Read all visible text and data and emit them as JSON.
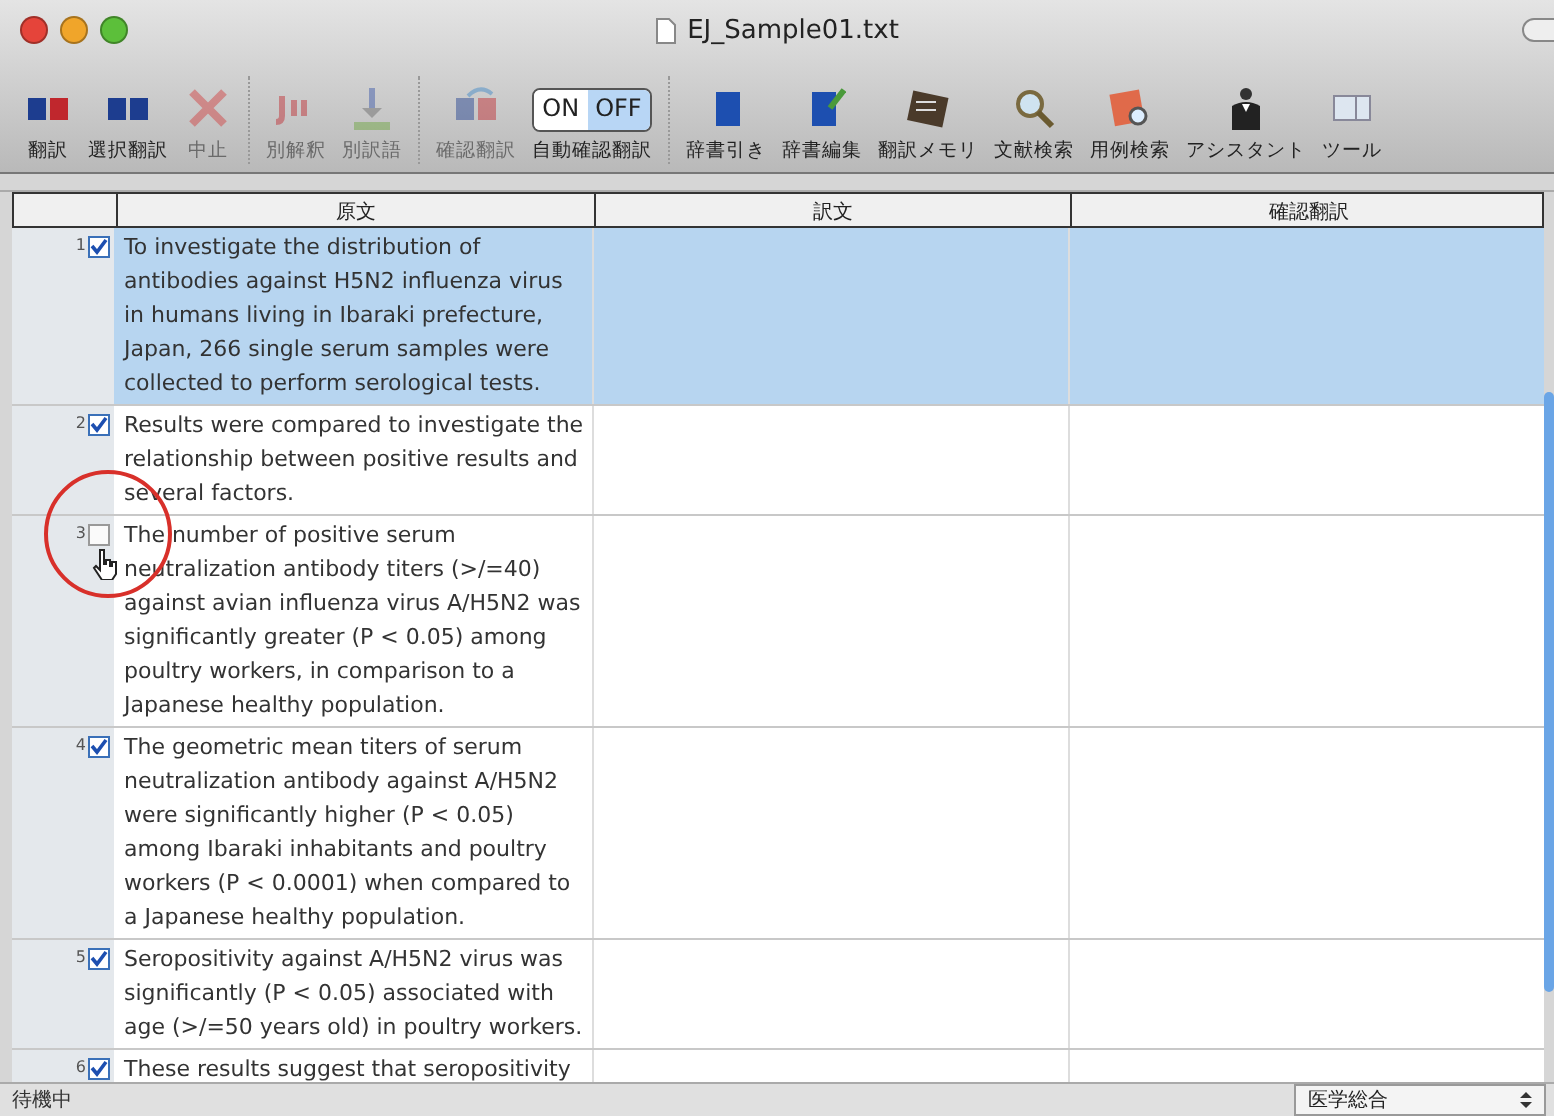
{
  "window": {
    "title": "EJ_Sample01.txt"
  },
  "toolbar": [
    {
      "kind": "exj",
      "label": "翻訳",
      "disabled": false,
      "separator_after": false
    },
    {
      "kind": "exj-select",
      "label": "選択翻訳",
      "disabled": false,
      "separator_after": false
    },
    {
      "kind": "stop",
      "label": "中止",
      "disabled": true,
      "separator_after": true
    },
    {
      "kind": "alt-meaning",
      "label": "別解釈",
      "disabled": true,
      "separator_after": false
    },
    {
      "kind": "alt-word",
      "label": "別訳語",
      "disabled": true,
      "separator_after": true
    },
    {
      "kind": "check",
      "label": "確認翻訳",
      "disabled": true,
      "separator_after": false
    },
    {
      "kind": "toggle",
      "label": "自動確認翻訳",
      "disabled": false,
      "separator_after": true,
      "options": [
        {
          "label": "ON",
          "selected": false
        },
        {
          "label": "OFF",
          "selected": true
        }
      ]
    },
    {
      "kind": "dict",
      "label": "辞書引き",
      "disabled": false,
      "separator_after": false
    },
    {
      "kind": "dict-edit",
      "label": "辞書編集",
      "disabled": false,
      "separator_after": false
    },
    {
      "kind": "memory",
      "label": "翻訳メモリ",
      "disabled": false,
      "separator_after": false
    },
    {
      "kind": "search",
      "label": "文献検索",
      "disabled": false,
      "separator_after": false
    },
    {
      "kind": "example",
      "label": "用例検索",
      "disabled": false,
      "separator_after": false
    },
    {
      "kind": "assistant",
      "label": "アシスタント",
      "disabled": false,
      "separator_after": false
    },
    {
      "kind": "tools",
      "label": "ツール",
      "disabled": false,
      "separator_after": false
    }
  ],
  "table": {
    "columns": [
      "原文",
      "訳文",
      "確認翻訳"
    ],
    "rows": [
      {
        "number": "1",
        "checked": true,
        "selected": true,
        "source": "To investigate the distribution of antibodies against H5N2 influenza virus in humans living in Ibaraki prefecture, Japan, 266 single serum samples were collected to perform serological tests."
      },
      {
        "number": "2",
        "checked": true,
        "selected": false,
        "source": "Results were compared to investigate the relationship between positive results and several factors."
      },
      {
        "number": "3",
        "checked": false,
        "selected": false,
        "source": "The number of positive serum neutralization antibody titers (>/=40) against avian influenza virus A/H5N2 was significantly greater (P < 0.05) among poultry workers, in comparison to a Japanese healthy population."
      },
      {
        "number": "4",
        "checked": true,
        "selected": false,
        "source": "The geometric mean titers of serum neutralization antibody against A/H5N2 were significantly higher (P < 0.05) among Ibaraki inhabitants and poultry workers (P < 0.0001) when compared to a Japanese healthy population."
      },
      {
        "number": "5",
        "checked": true,
        "selected": false,
        "source": "Seropositivity against A/H5N2 virus was significantly (P < 0.05) associated with age (>/=50 years old) in poultry workers."
      },
      {
        "number": "6",
        "checked": true,
        "selected": false,
        "source": "These results suggest that seropositivity"
      }
    ]
  },
  "status_bar": {
    "status": "待機中",
    "dictionary": "医学総合"
  }
}
